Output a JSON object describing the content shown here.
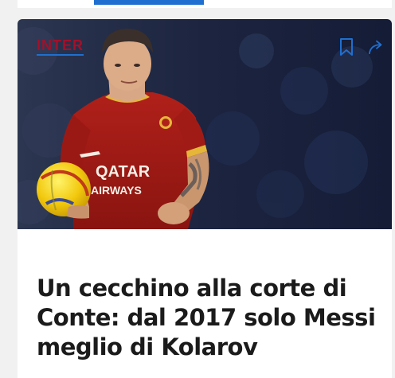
{
  "article": {
    "category": "INTER",
    "headline": "Un cecchino alla corte di Conte: dal 2017 solo Messi meglio di Kolarov",
    "image": {
      "subject": "player-in-red-jersey-holding-ball",
      "shirt_text_line1": "QATAR",
      "shirt_text_line2": "AIRWAYS"
    },
    "actions": {
      "bookmark_icon": "bookmark-icon",
      "share_icon": "share-arrow-icon"
    }
  },
  "colors": {
    "category_text": "#a3102a",
    "accent_blue": "#1f6fd0",
    "headline_text": "#1b1b1b",
    "page_background": "#f1f1f1",
    "card_background": "#ffffff"
  }
}
